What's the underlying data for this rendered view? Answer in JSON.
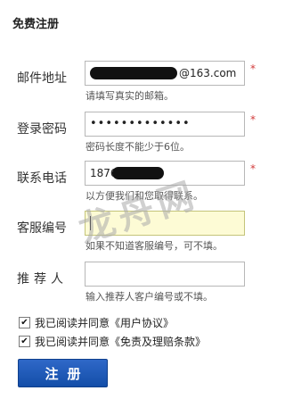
{
  "form": {
    "title": "免费注册",
    "fields": {
      "email": {
        "label": "邮件地址",
        "value": "@163.com",
        "hint": "请填写真实的邮箱。",
        "required_mark": "*"
      },
      "password": {
        "label": "登录密码",
        "value": "•••••••••••••",
        "hint": "密码长度不能少于6位。",
        "required_mark": "*"
      },
      "phone": {
        "label": "联系电话",
        "value": "1876",
        "hint": "以方便我们和您取得联系。",
        "required_mark": "*"
      },
      "service_id": {
        "label": "客服编号",
        "value": "",
        "hint": "如果不知道客服编号，可不填。"
      },
      "referrer": {
        "label": "推荐人",
        "value": "",
        "hint": "输入推荐人客户编号或不填。"
      }
    },
    "agreements": [
      {
        "checked": true,
        "check_glyph": "✔",
        "text": "我已阅读并同意《用户协议》"
      },
      {
        "checked": true,
        "check_glyph": "✔",
        "text": "我已阅读并同意《免责及理赔条款》"
      }
    ],
    "submit_label": "注册",
    "watermark_text": "龙舟网"
  },
  "colors": {
    "required_mark": "#d23b3b",
    "submit_button": "#1a56b8",
    "focused_field_bg": "#fdfbd5",
    "field_border": "#b7b7b7"
  }
}
